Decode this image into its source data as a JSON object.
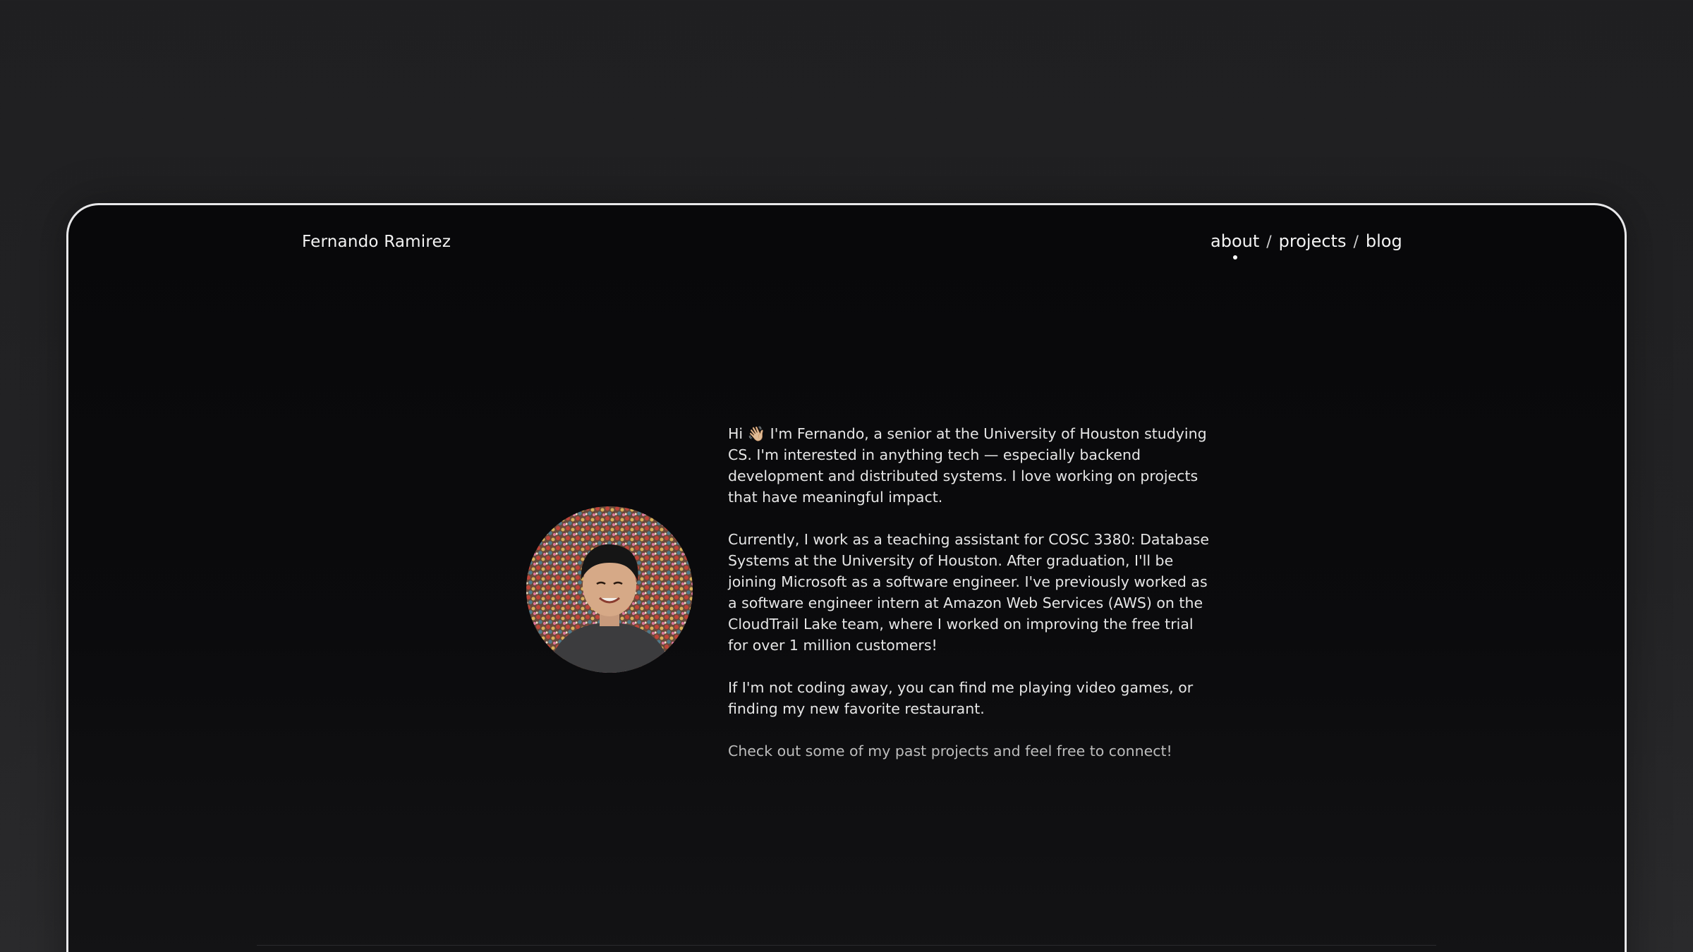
{
  "header": {
    "site_title": "Fernando Ramirez",
    "nav": {
      "about": "about",
      "projects": "projects",
      "blog": "blog",
      "separator": "/",
      "active": "about"
    }
  },
  "profile": {
    "avatar_icon": "profile-photo"
  },
  "bio": {
    "p1": "Hi 👋🏼 I'm Fernando, a senior at the University of Houston studying CS. I'm interested in anything tech — especially backend development and distributed systems. I love working on projects that have meaningful impact.",
    "p2": "Currently, I work as a teaching assistant for COSC 3380: Database Systems at the University of Houston. After graduation, I'll be joining Microsoft as a software engineer. I've previously worked as a software engineer intern at Amazon Web Services (AWS) on the CloudTrail Lake team, where I worked on improving the free trial for over 1 million customers!",
    "p3": "If I'm not coding away, you can find me playing video games, or finding my new favorite restaurant.",
    "p4": "Check out some of my past projects and feel free to connect!"
  },
  "colors": {
    "background": "#222224",
    "frame_border": "#e8e8ea",
    "frame_fill": "#0a0a0c",
    "text": "#e6e6e6",
    "muted_text": "#bdbdbd"
  }
}
